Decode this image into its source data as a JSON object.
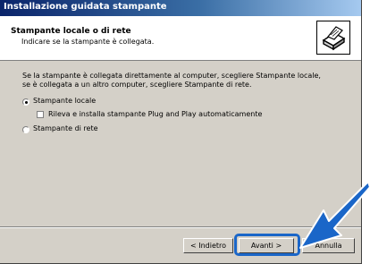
{
  "window": {
    "title": "Installazione guidata stampante"
  },
  "header": {
    "title": "Stampante locale o di rete",
    "subtitle": "Indicare se la stampante è collegata.",
    "icon": "printer-icon"
  },
  "body": {
    "description": "Se la stampante è collegata direttamente al computer, scegliere Stampante locale, se è collegata a un altro computer, scegliere Stampante di rete.",
    "options": {
      "local": {
        "label": "Stampante locale",
        "selected": true
      },
      "pnp": {
        "label": "Rileva e installa stampante Plug and Play automaticamente",
        "checked": false
      },
      "network": {
        "label": "Stampante di rete",
        "selected": false
      }
    }
  },
  "buttons": {
    "back": "< Indietro",
    "next": "Avanti >",
    "cancel": "Annulla"
  },
  "annotation": {
    "arrow_color": "#1a66c8",
    "icon": "arrow-pointer-icon"
  }
}
